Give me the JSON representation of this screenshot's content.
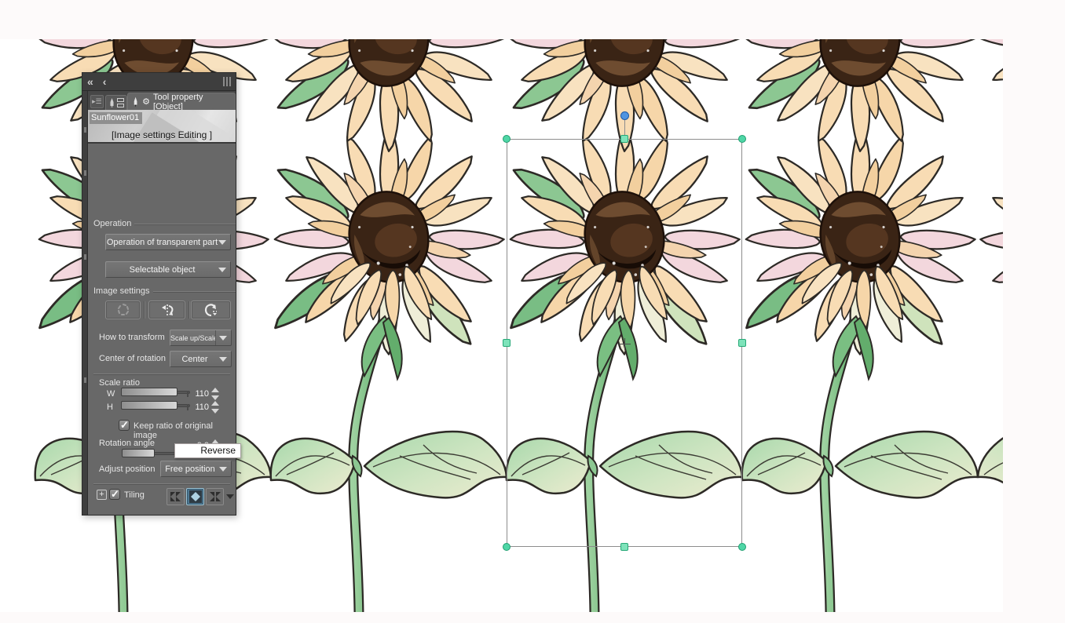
{
  "panel": {
    "topbar": {
      "collapse_label": "«",
      "back_label": "‹"
    },
    "tabs": {
      "active_label": "Tool property [Object]"
    },
    "header": {
      "object_name": "Sunflower01",
      "status": "[Image settings Editing ]"
    },
    "operation": {
      "group_label": "Operation",
      "transparent_part_value": "Operation of transparent part",
      "selectable_object_value": "Selectable object"
    },
    "image_settings": {
      "group_label": "Image settings",
      "buttons": [
        {
          "name": "free-transform"
        },
        {
          "name": "flip-horizontal"
        },
        {
          "name": "rotate"
        }
      ],
      "how_to_transform": {
        "label": "How to transform",
        "value": "Scale up/Scale"
      },
      "center_of_rotation": {
        "label": "Center of rotation",
        "value": "Center"
      },
      "scale_ratio": {
        "label": "Scale ratio",
        "w_label": "W",
        "w_value": "110",
        "h_label": "H",
        "h_value": "110"
      },
      "keep_ratio_label": "Keep ratio of original image",
      "keep_ratio_checked": true,
      "rotation_angle": {
        "label": "Rotation angle",
        "value": "0.0"
      },
      "adjust_position": {
        "label": "Adjust position",
        "value": "Free position"
      }
    },
    "tiling": {
      "label": "Tiling",
      "checked": true,
      "expand_label": "+",
      "modes": [
        "repeat",
        "reverse",
        "flip"
      ],
      "selected_mode": "reverse"
    },
    "tooltip": "Reverse"
  },
  "canvas": {
    "artwork": "tiled sunflower illustration, 110% scaled object selected",
    "selection_handles": "transform selection around center tile"
  },
  "colors": {
    "panel_bg": "#686868",
    "panel_topbar": "#3e3e3e",
    "selected_mode_blue": "#4e7892",
    "handle_mint": "#7ee3ba",
    "handle_mint_border": "#26a877",
    "rotation_handle_blue": "#4f94e0",
    "petal_cream": "#f8dcb4",
    "petal_pink": "#f3d7dd",
    "flower_center_brown": "#3a2415",
    "leaf_green": "#a8d8ab",
    "canvas_white": "#ffffff",
    "app_bg": "#fdfafa"
  }
}
